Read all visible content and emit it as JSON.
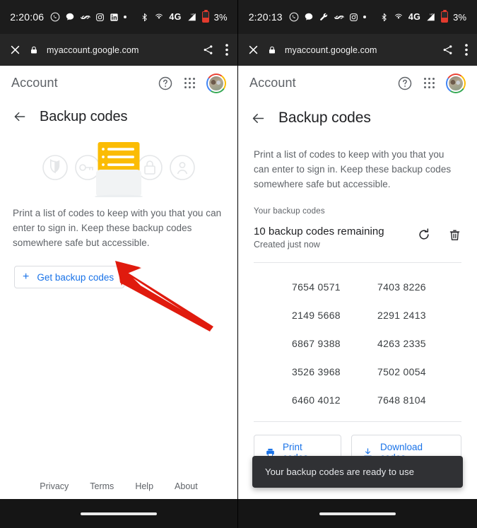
{
  "left": {
    "status_bar": {
      "time": "2:20:06",
      "icons": [
        "whatsapp-icon",
        "chat-bubble-icon",
        "link-loop-icon",
        "instagram-icon",
        "linkedin-icon",
        "dot-separator",
        "bluetooth-icon",
        "cast-icon"
      ],
      "network": "4G",
      "battery_percent": "3%"
    },
    "browser": {
      "close_label": "close-icon",
      "lock_label": "lock-icon",
      "url": "myaccount.google.com",
      "share_label": "share-icon",
      "menu_label": "more-vertical-icon"
    },
    "header": {
      "title": "Account"
    },
    "page": {
      "title": "Backup codes",
      "description": "Print a list of codes to keep with you that you can enter to sign in. Keep these backup codes somewhere safe but accessible.",
      "get_codes_button": "Get backup codes",
      "plus": "+"
    },
    "footer": [
      "Privacy",
      "Terms",
      "Help",
      "About"
    ]
  },
  "right": {
    "status_bar": {
      "time": "2:20:13",
      "icons": [
        "whatsapp-icon",
        "chat-bubble-icon",
        "wrench-icon",
        "link-loop-icon",
        "instagram-icon",
        "dot-separator",
        "bluetooth-icon",
        "cast-icon"
      ],
      "network": "4G",
      "battery_percent": "3%"
    },
    "browser": {
      "url": "myaccount.google.com"
    },
    "header": {
      "title": "Account"
    },
    "page": {
      "title": "Backup codes",
      "description": "Print a list of codes to keep with you that you can enter to sign in. Keep these backup codes somewhere safe but accessible.",
      "section_label": "Your backup codes",
      "remaining": "10 backup codes remaining",
      "created": "Created just now",
      "refresh_icon": "refresh-icon",
      "delete_icon": "trash-icon"
    },
    "codes": [
      "7654 0571",
      "7403 8226",
      "2149 5668",
      "2291 2413",
      "6867 9388",
      "4263 2335",
      "3526 3968",
      "7502 0054",
      "6460 4012",
      "7648 8104"
    ],
    "actions": {
      "print": "Print codes",
      "download": "Download codes"
    },
    "toast": "Your backup codes are ready to use"
  },
  "colors": {
    "google_blue": "#1a73e8",
    "annotation_red": "#e01b0e",
    "card_yellow": "#fbbc04",
    "status_bar_bg": "#1c1c1c"
  }
}
